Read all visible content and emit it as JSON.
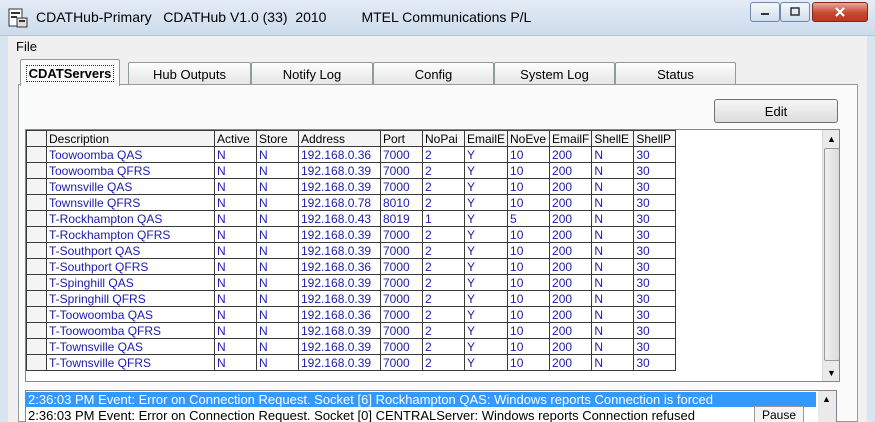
{
  "window": {
    "title": "CDATHub-Primary   CDATHub V1.0 (33)  2010         MTEL Communications P/L",
    "min_icon": "minimize-icon",
    "max_icon": "maximize-icon",
    "close_icon": "close-icon"
  },
  "menu": {
    "file": "File"
  },
  "tabs": [
    {
      "label": "CDATServers",
      "active": true
    },
    {
      "label": "Hub Outputs",
      "active": false
    },
    {
      "label": "Notify Log",
      "active": false
    },
    {
      "label": "Config",
      "active": false
    },
    {
      "label": "System Log",
      "active": false
    },
    {
      "label": "Status",
      "active": false
    }
  ],
  "edit_label": "Edit",
  "grid": {
    "columns": [
      "Description",
      "Active",
      "Store",
      "Address",
      "Port",
      "NoPai",
      "EmailE",
      "NoEve",
      "EmailF",
      "ShellE",
      "ShellP"
    ],
    "rows": [
      [
        "Toowoomba QAS",
        "N",
        "N",
        "192.168.0.36",
        "7000",
        "2",
        "Y",
        "10",
        "200",
        "N",
        "30"
      ],
      [
        "Toowoomba QFRS",
        "N",
        "N",
        "192.168.0.39",
        "7000",
        "2",
        "Y",
        "10",
        "200",
        "N",
        "30"
      ],
      [
        "Townsville QAS",
        "N",
        "N",
        "192.168.0.39",
        "7000",
        "2",
        "Y",
        "10",
        "200",
        "N",
        "30"
      ],
      [
        "Townsville QFRS",
        "N",
        "N",
        "192.168.0.78",
        "8010",
        "2",
        "Y",
        "10",
        "200",
        "N",
        "30"
      ],
      [
        "T-Rockhampton QAS",
        "N",
        "N",
        "192.168.0.43",
        "8019",
        "1",
        "Y",
        "5",
        "200",
        "N",
        "30"
      ],
      [
        "T-Rockhampton QFRS",
        "N",
        "N",
        "192.168.0.39",
        "7000",
        "2",
        "Y",
        "10",
        "200",
        "N",
        "30"
      ],
      [
        "T-Southport QAS",
        "N",
        "N",
        "192.168.0.39",
        "7000",
        "2",
        "Y",
        "10",
        "200",
        "N",
        "30"
      ],
      [
        "T-Southport QFRS",
        "N",
        "N",
        "192.168.0.36",
        "7000",
        "2",
        "Y",
        "10",
        "200",
        "N",
        "30"
      ],
      [
        "T-Spinghill QAS",
        "N",
        "N",
        "192.168.0.39",
        "7000",
        "2",
        "Y",
        "10",
        "200",
        "N",
        "30"
      ],
      [
        "T-Springhill QFRS",
        "N",
        "N",
        "192.168.0.39",
        "7000",
        "2",
        "Y",
        "10",
        "200",
        "N",
        "30"
      ],
      [
        "T-Toowoomba QAS",
        "N",
        "N",
        "192.168.0.36",
        "7000",
        "2",
        "Y",
        "10",
        "200",
        "N",
        "30"
      ],
      [
        "T-Toowoomba QFRS",
        "N",
        "N",
        "192.168.0.39",
        "7000",
        "2",
        "Y",
        "10",
        "200",
        "N",
        "30"
      ],
      [
        "T-Townsville QAS",
        "N",
        "N",
        "192.168.0.39",
        "7000",
        "2",
        "Y",
        "10",
        "200",
        "N",
        "30"
      ],
      [
        "T-Townsville QFRS",
        "N",
        "N",
        "192.168.0.39",
        "7000",
        "2",
        "Y",
        "10",
        "200",
        "N",
        "30"
      ]
    ]
  },
  "log": {
    "lines": [
      "2:36:03 PM  Event: Error on Connection Request. Socket [6]  Rockhampton QAS: Windows reports Connection is forced",
      "2:36:03 PM  Event: Error on Connection Request. Socket [0]  CENTRALServer: Windows reports Connection refused"
    ],
    "pause_label": "Pause"
  },
  "colors": {
    "cell_text": "#1b1bb0",
    "selection": "#3399ff"
  }
}
